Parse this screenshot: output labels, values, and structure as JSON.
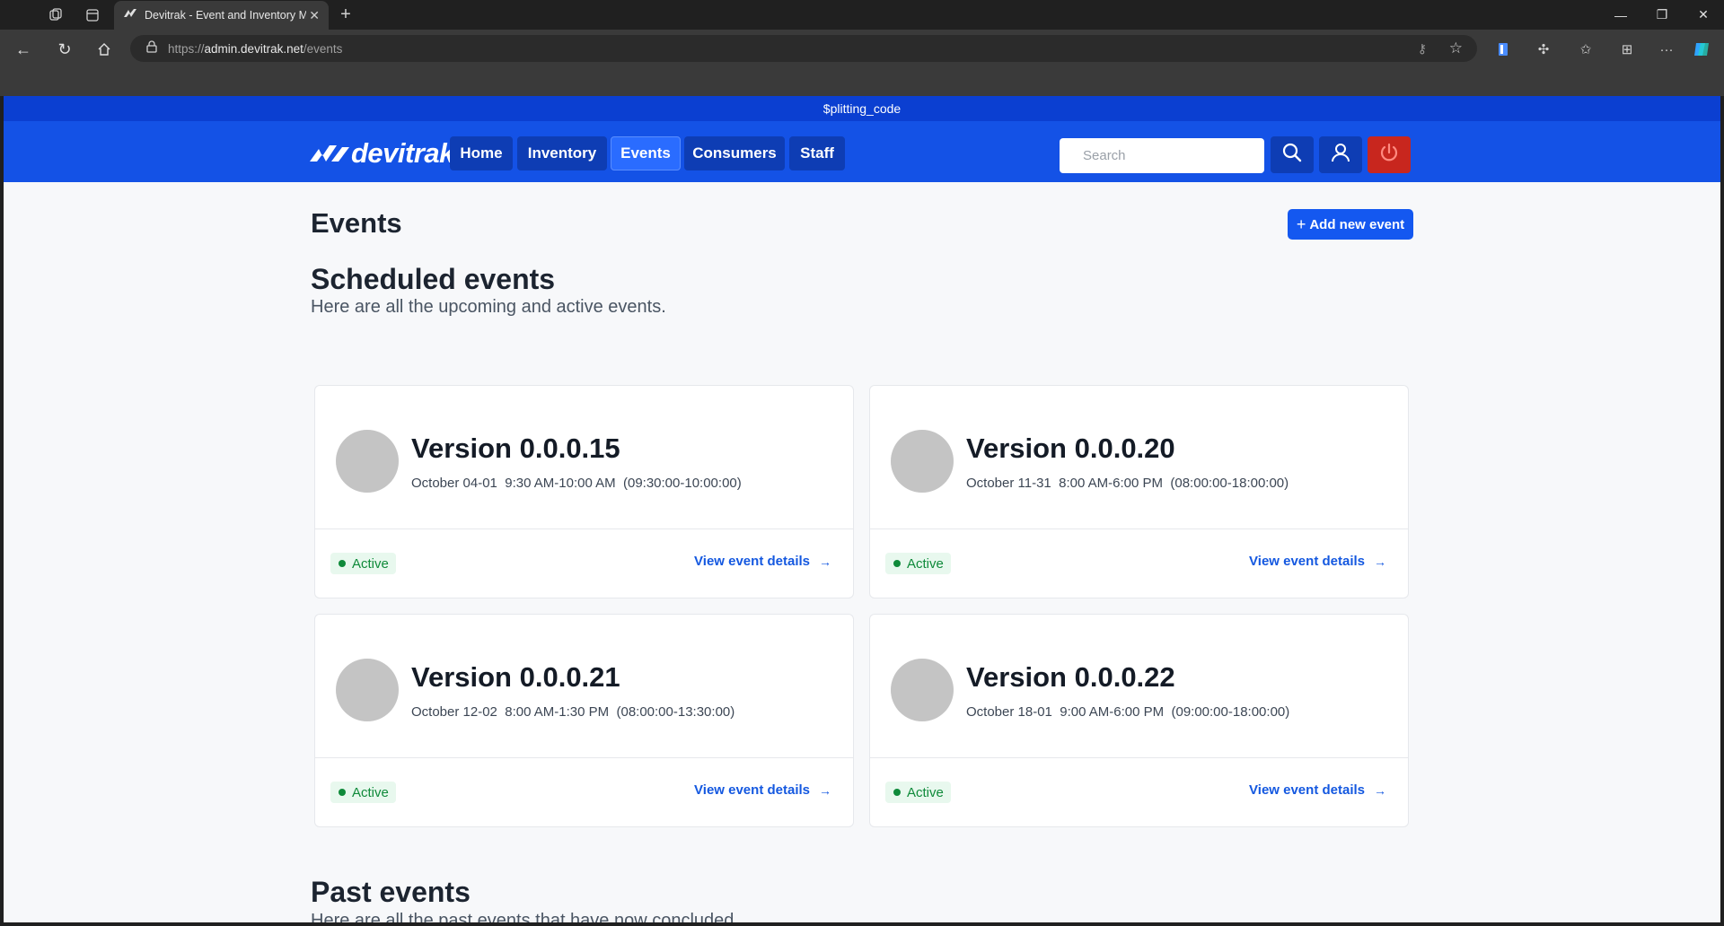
{
  "browser": {
    "tab_title": "Devitrak - Event and Inventory Management",
    "url_scheme": "https://",
    "url_host": "admin.devitrak.net",
    "url_path": "/events"
  },
  "banner": {
    "text": "$plitting_code"
  },
  "nav": {
    "logo": "devitrak",
    "items": [
      {
        "label": "Home"
      },
      {
        "label": "Inventory"
      },
      {
        "label": "Events"
      },
      {
        "label": "Consumers"
      },
      {
        "label": "Staff"
      }
    ],
    "active": "Events",
    "search_placeholder": "Search"
  },
  "page": {
    "title": "Events",
    "add_button": "Add new event",
    "scheduled": {
      "title": "Scheduled events",
      "subtitle": "Here are all the upcoming and active events."
    },
    "past": {
      "title": "Past events",
      "subtitle": "Here are all the past events that have now concluded."
    }
  },
  "events": [
    {
      "name": "Version 0.0.0.15",
      "dates": "October 04-01",
      "time": "9:30 AM-10:00 AM",
      "range": "(09:30:00-10:00:00)",
      "status": "Active",
      "link": "View event details"
    },
    {
      "name": "Version 0.0.0.20",
      "dates": "October 11-31",
      "time": "8:00 AM-6:00 PM",
      "range": "(08:00:00-18:00:00)",
      "status": "Active",
      "link": "View event details"
    },
    {
      "name": "Version 0.0.0.21",
      "dates": "October 12-02",
      "time": "8:00 AM-1:30 PM",
      "range": "(08:00:00-13:30:00)",
      "status": "Active",
      "link": "View event details"
    },
    {
      "name": "Version 0.0.0.22",
      "dates": "October 18-01",
      "time": "9:00 AM-6:00 PM",
      "range": "(09:00:00-18:00:00)",
      "status": "Active",
      "link": "View event details"
    }
  ],
  "colors": {
    "nav_blue": "#1452e6",
    "banner_blue": "#0b3fd1",
    "logout_red": "#c8261e",
    "active_green": "#0f8a3a"
  }
}
